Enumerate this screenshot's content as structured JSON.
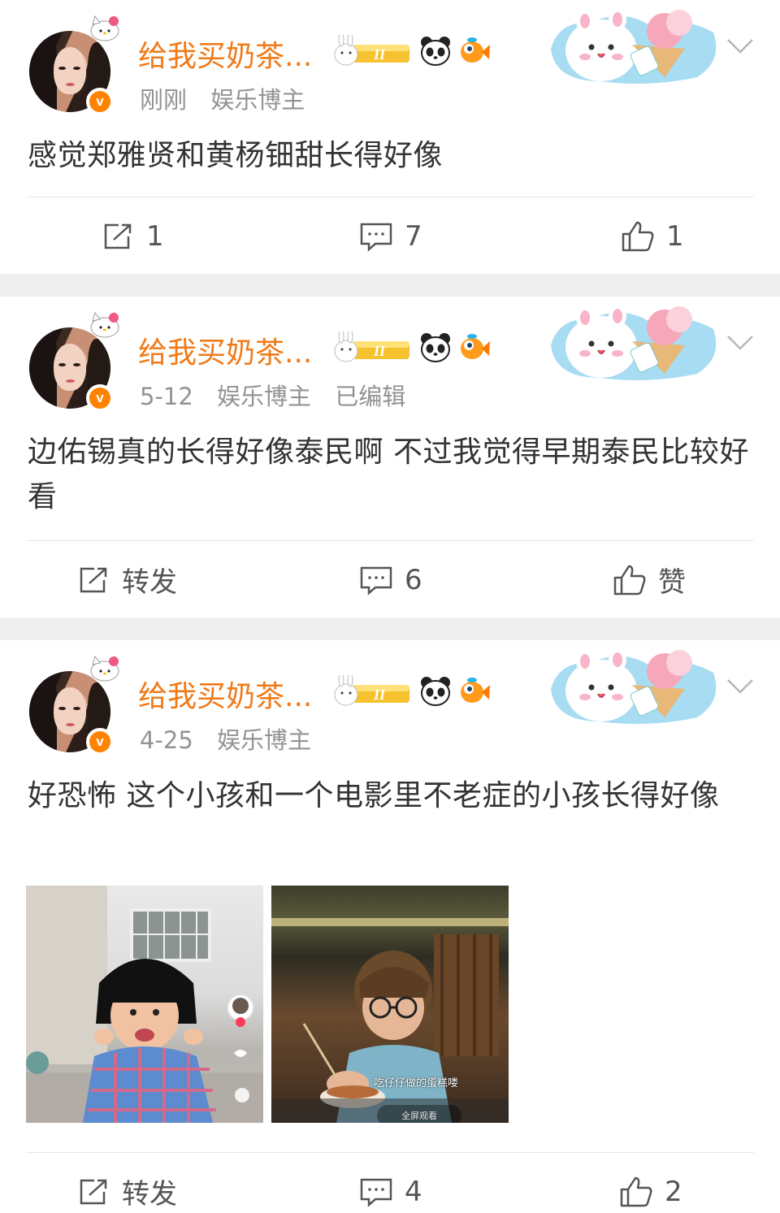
{
  "colors": {
    "accent": "#ff8200",
    "username": "#f07a18",
    "meta": "#939393",
    "text": "#333333",
    "separator": "#efefef"
  },
  "posts": [
    {
      "username": "给我买奶茶...",
      "verified_mark": "v",
      "level_mark": "II",
      "time": "刚刚",
      "tag": "娱乐博主",
      "edited": "",
      "content": "感觉郑雅贤和黄杨钿甜长得好像",
      "actions": {
        "repost": "1",
        "comment": "7",
        "like": "1"
      }
    },
    {
      "username": "给我买奶茶...",
      "verified_mark": "v",
      "level_mark": "II",
      "time": "5-12",
      "tag": "娱乐博主",
      "edited": "已编辑",
      "content": "边佑锡真的长得好像泰民啊  不过我觉得早期泰民比较好看",
      "actions": {
        "repost": "转发",
        "comment": "6",
        "like": "赞"
      }
    },
    {
      "username": "给我买奶茶...",
      "verified_mark": "v",
      "level_mark": "II",
      "time": "4-25",
      "tag": "娱乐博主",
      "edited": "",
      "content": "好恐怖 这个小孩和一个电影里不老症的小孩长得好像",
      "images": [
        {
          "icon": "child-photo"
        },
        {
          "icon": "movie-still",
          "caption": "吃仔仔做的蛋糕喽",
          "button": "全屏观看"
        }
      ],
      "actions": {
        "repost": "转发",
        "comment": "4",
        "like": "2"
      }
    }
  ]
}
